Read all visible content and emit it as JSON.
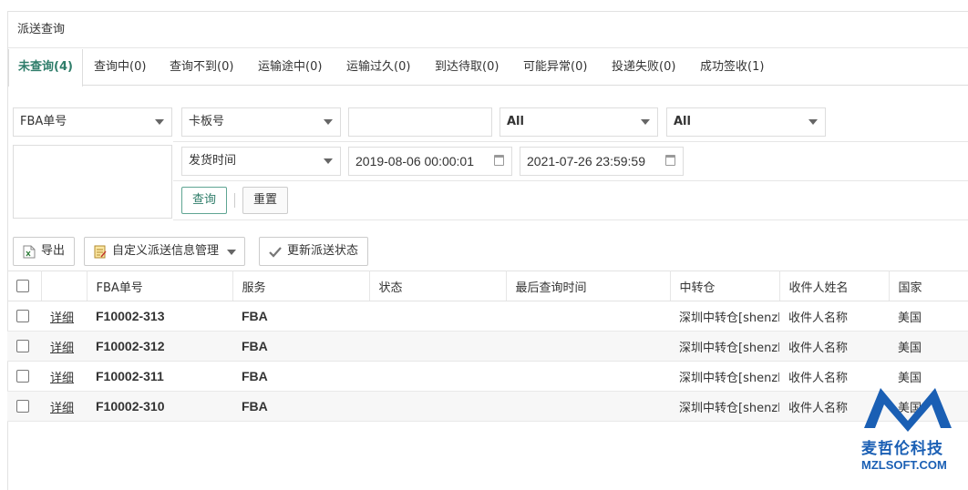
{
  "panel": {
    "title": "派送查询"
  },
  "tabs": [
    {
      "label": "未查询(4)"
    },
    {
      "label": "查询中(0)"
    },
    {
      "label": "查询不到(0)"
    },
    {
      "label": "运输途中(0)"
    },
    {
      "label": "运输过久(0)"
    },
    {
      "label": "到达待取(0)"
    },
    {
      "label": "可能异常(0)"
    },
    {
      "label": "投递失败(0)"
    },
    {
      "label": "成功签收(1)"
    }
  ],
  "filters": {
    "field1": "FBA单号",
    "field2": "卡板号",
    "text_value": "",
    "select3": "All",
    "select4": "All",
    "date_type": "发货时间",
    "date_from": "2019-08-06 00:00:01",
    "date_to": "2021-07-26 23:59:59",
    "search_label": "查询",
    "reset_label": "重置"
  },
  "toolbar": {
    "export_label": "导出",
    "custom_label": "自定义派送信息管理",
    "update_label": "更新派送状态"
  },
  "table": {
    "headers": [
      "",
      "",
      "FBA单号",
      "服务",
      "状态",
      "最后查询时间",
      "中转仓",
      "收件人姓名",
      "国家"
    ],
    "rows": [
      {
        "detail": "详细",
        "fba": "F10002-313",
        "service": "FBA",
        "status": "",
        "last_query": "",
        "transit": "深圳中转仓[shenzhen]",
        "recipient": "收件人名称",
        "country": "美国"
      },
      {
        "detail": "详细",
        "fba": "F10002-312",
        "service": "FBA",
        "status": "",
        "last_query": "",
        "transit": "深圳中转仓[shenzhen]",
        "recipient": "收件人名称",
        "country": "美国"
      },
      {
        "detail": "详细",
        "fba": "F10002-311",
        "service": "FBA",
        "status": "",
        "last_query": "",
        "transit": "深圳中转仓[shenzhen]",
        "recipient": "收件人名称",
        "country": "美国"
      },
      {
        "detail": "详细",
        "fba": "F10002-310",
        "service": "FBA",
        "status": "",
        "last_query": "",
        "transit": "深圳中转仓[shenzhen]",
        "recipient": "收件人名称",
        "country": "美国"
      }
    ]
  },
  "watermark": {
    "cn": "麦哲伦科技",
    "en": "MZLSOFT.COM",
    "color": "#1a5fb4"
  },
  "colors": {
    "accent": "#2f7d6a"
  }
}
